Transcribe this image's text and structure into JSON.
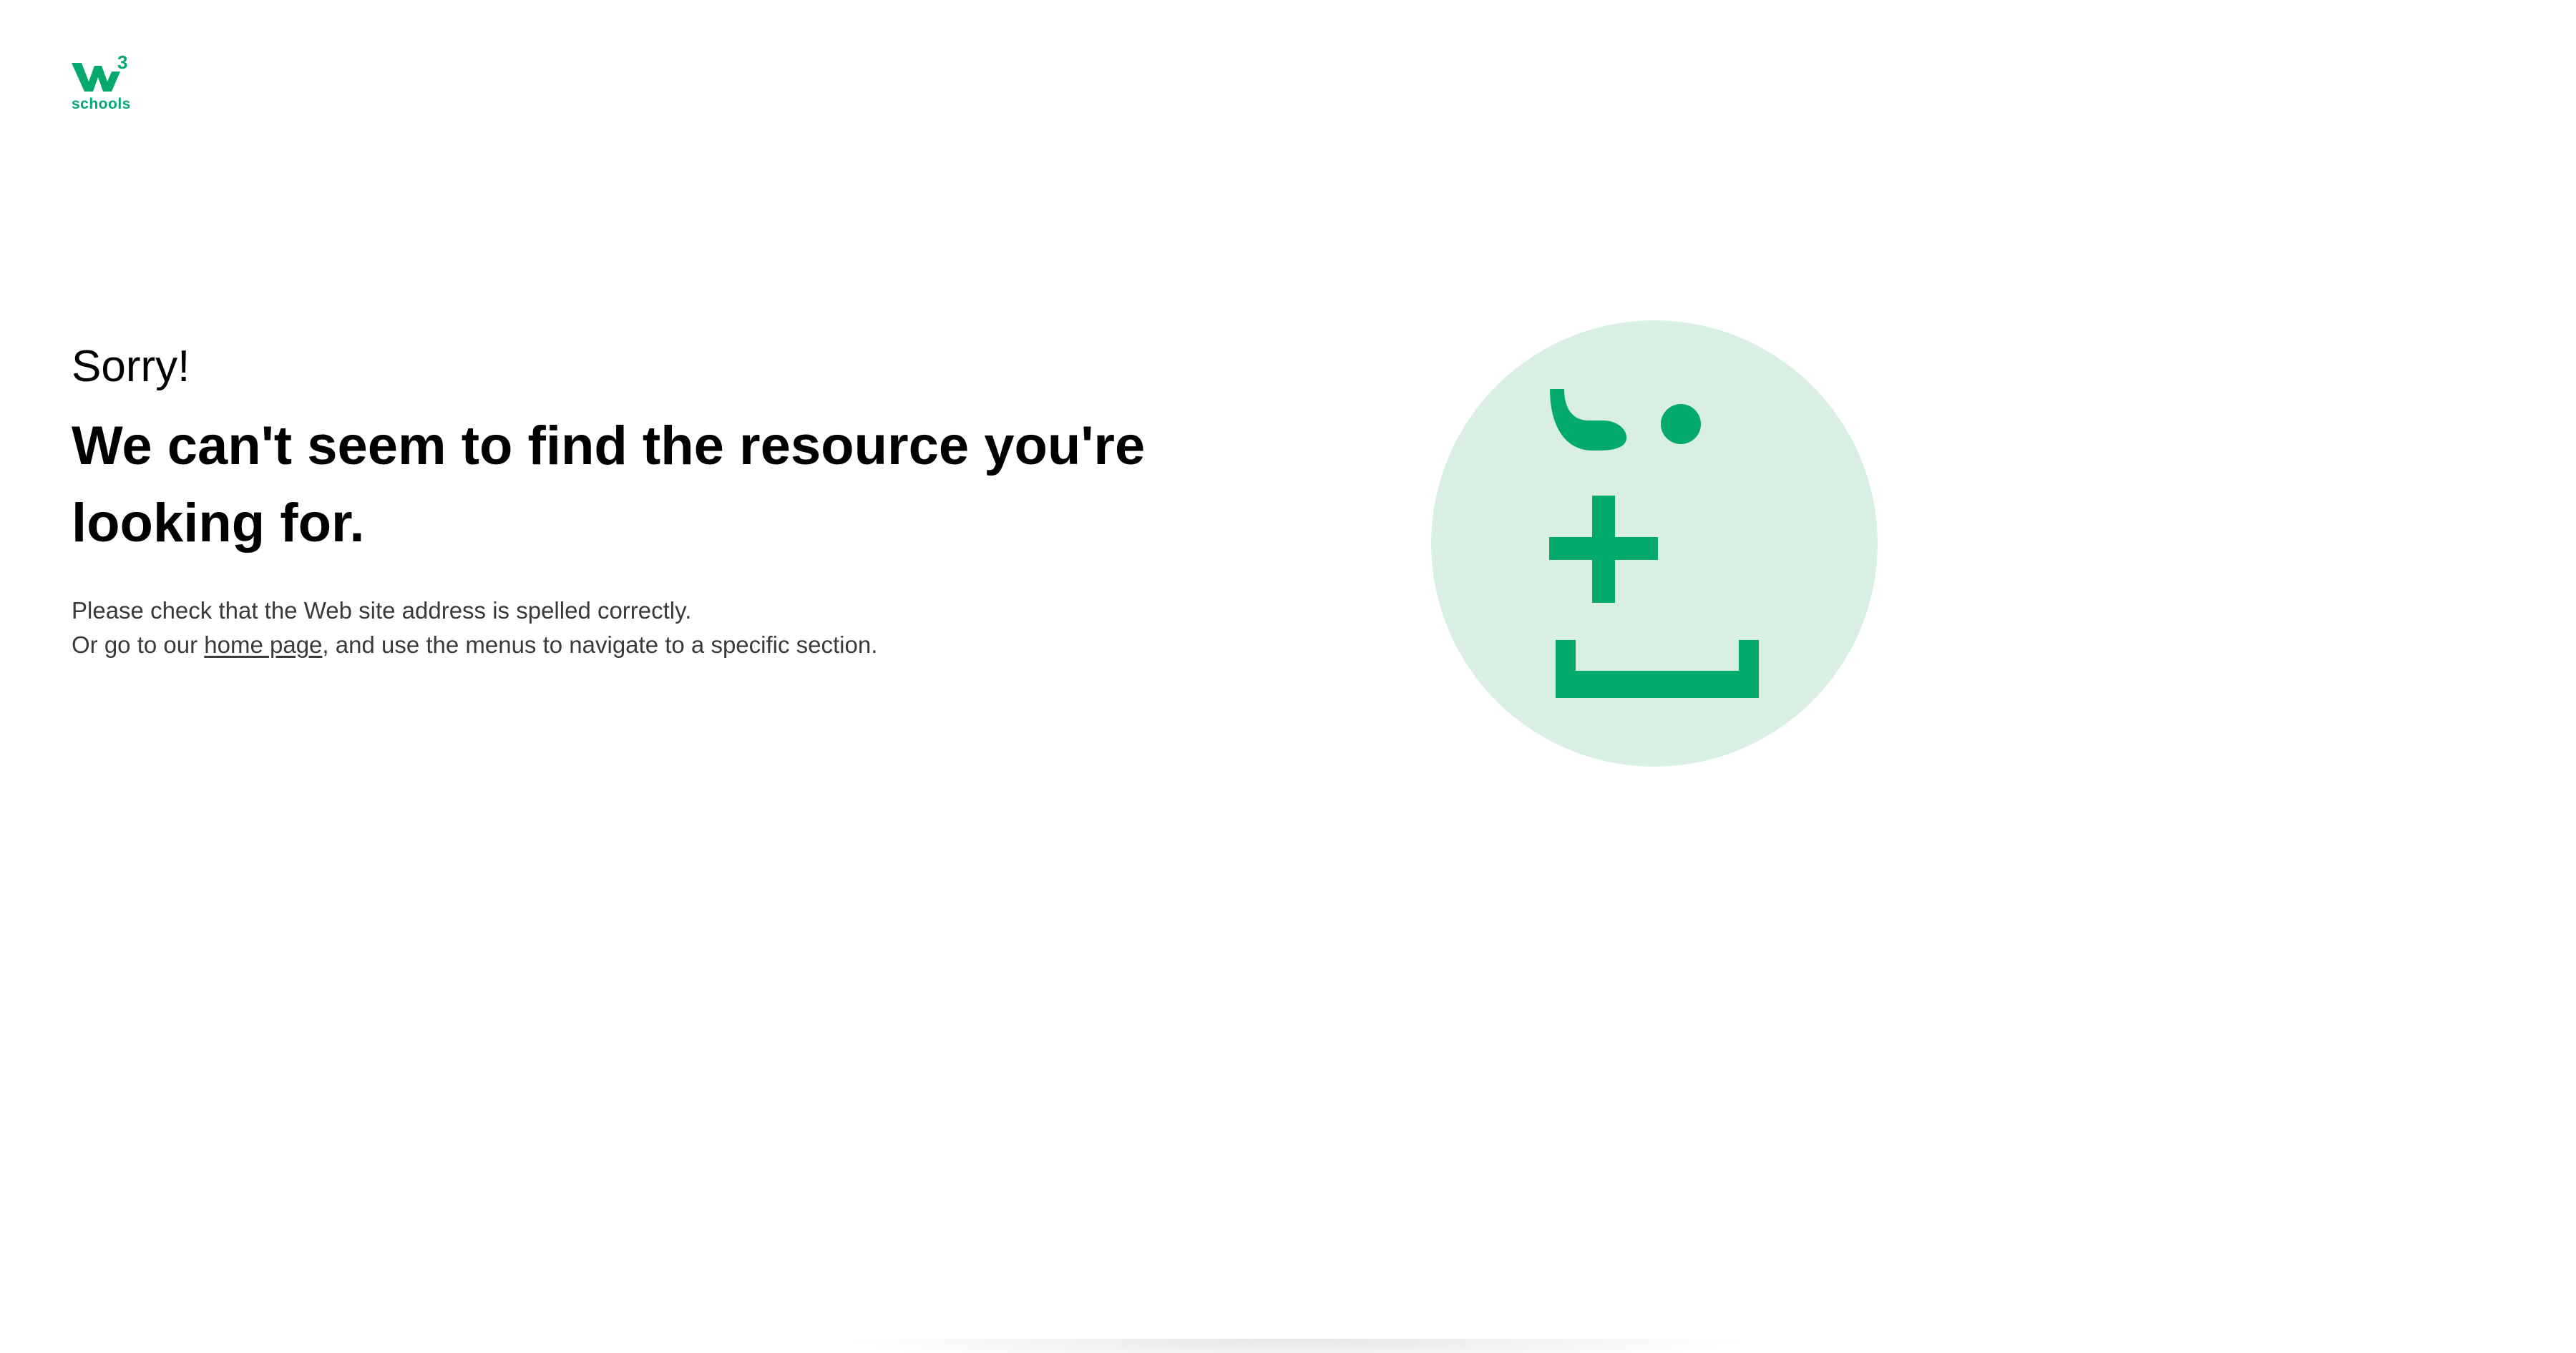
{
  "brand": {
    "logo_mark": "W",
    "logo_superscript": "3",
    "logo_text": "schools",
    "accent_color": "#04aa6d",
    "light_accent_color": "#d9efe3"
  },
  "error": {
    "greeting": "Sorry!",
    "headline": "We can't seem to find the resource you're looking for.",
    "line1": "Please check that the Web site address is spelled correctly.",
    "line2_prefix": "Or go to our ",
    "line2_link": "home page",
    "line2_suffix": ", and use the menus to navigate to a specific section."
  },
  "illustration": {
    "icon": "confused-face-icon"
  }
}
